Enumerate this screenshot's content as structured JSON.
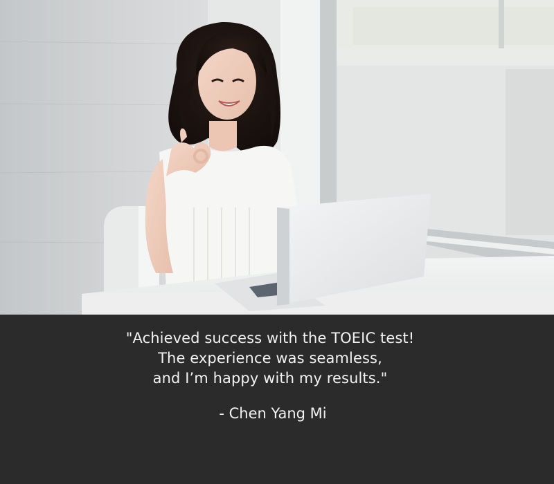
{
  "testimonial": {
    "quote_lines": [
      "\"Achieved success with the TOEIC test!",
      "The experience was seamless,",
      "and I’m happy with my results.\""
    ],
    "author": "- Chen Yang Mi"
  },
  "photo": {
    "subject": "smiling-woman-with-laptop-ok-gesture"
  },
  "colors": {
    "caption_background": "#2b2b2b",
    "caption_text": "#f2f2f2"
  }
}
